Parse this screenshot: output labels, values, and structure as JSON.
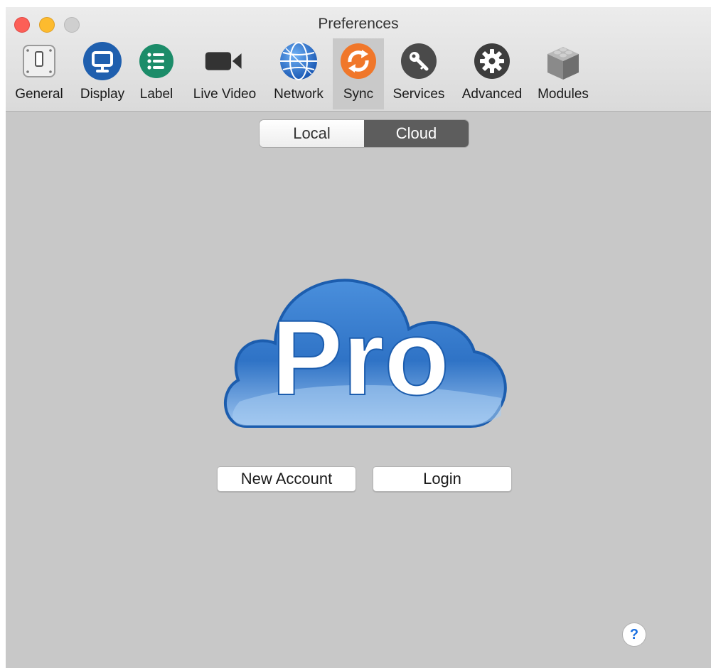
{
  "window": {
    "title": "Preferences"
  },
  "toolbar": {
    "items": [
      {
        "label": "General",
        "icon": "switch-icon"
      },
      {
        "label": "Display",
        "icon": "monitor-icon"
      },
      {
        "label": "Label",
        "icon": "list-icon"
      },
      {
        "label": "Live Video",
        "icon": "video-camera-icon"
      },
      {
        "label": "Network",
        "icon": "globe-icon"
      },
      {
        "label": "Sync",
        "icon": "sync-icon",
        "selected": true
      },
      {
        "label": "Services",
        "icon": "key-icon"
      },
      {
        "label": "Advanced",
        "icon": "gear-icon"
      },
      {
        "label": "Modules",
        "icon": "cube-icon"
      }
    ]
  },
  "segmented": {
    "options": [
      "Local",
      "Cloud"
    ],
    "selected": "Cloud"
  },
  "logo": {
    "text": "Pro"
  },
  "actions": {
    "new_account": "New Account",
    "login": "Login"
  },
  "help": {
    "label": "?"
  },
  "colors": {
    "sync_orange": "#f0772a",
    "display_blue": "#1f5fae",
    "label_green": "#1c8c69",
    "cloud_blue": "#2f73c6"
  }
}
